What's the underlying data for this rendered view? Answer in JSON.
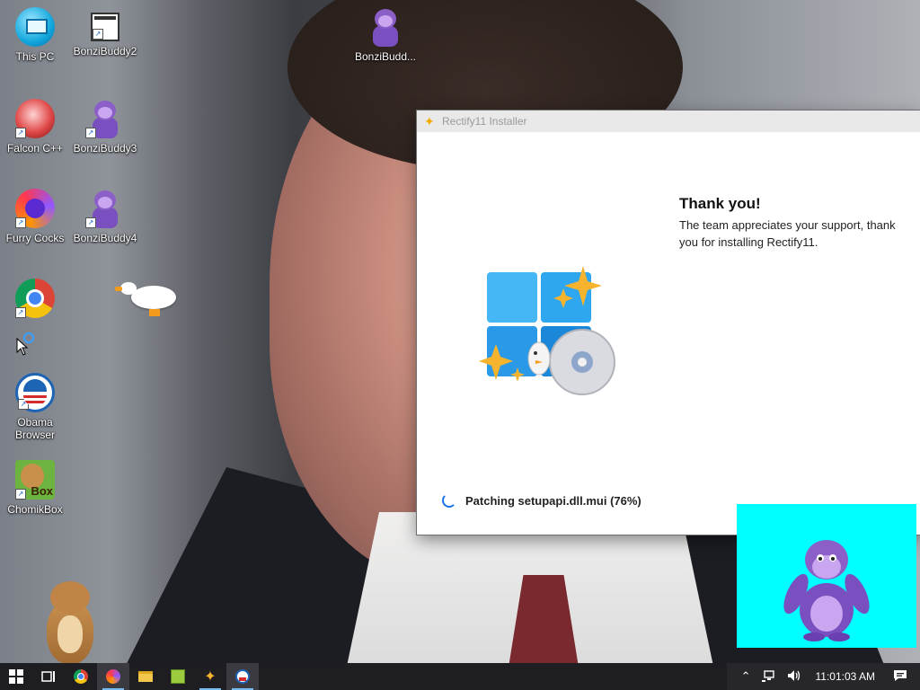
{
  "desktop": {
    "icons": [
      {
        "label": "This PC"
      },
      {
        "label": "BonziBuddy2"
      },
      {
        "label": "BonziBudd..."
      },
      {
        "label": "Falcon C++"
      },
      {
        "label": "BonziBuddy3"
      },
      {
        "label": "Furry Cocks"
      },
      {
        "label": "BonziBuddy4"
      },
      {
        "label": "Obama Browser"
      },
      {
        "label": "ChomikBox"
      }
    ],
    "chomik_badge": "Box"
  },
  "installer": {
    "title": "Rectify11 Installer",
    "heading": "Thank you!",
    "description": "The team appreciates your support, thank you for installing Rectify11.",
    "progress_text": "Patching setupapi.dll.mui (76%)",
    "progress_percent": 76
  },
  "taskbar": {
    "apps": [
      "start-icon",
      "task-view-icon",
      "chrome-icon",
      "firefox-icon",
      "file-explorer-icon",
      "notepad-icon",
      "rectify11-icon",
      "obama-browser-icon"
    ],
    "clock": "11:01:03 AM"
  },
  "colors": {
    "taskbar": "#1e1e22",
    "bonzi_bg": "#00ffff",
    "accent": "#1a73e8"
  }
}
